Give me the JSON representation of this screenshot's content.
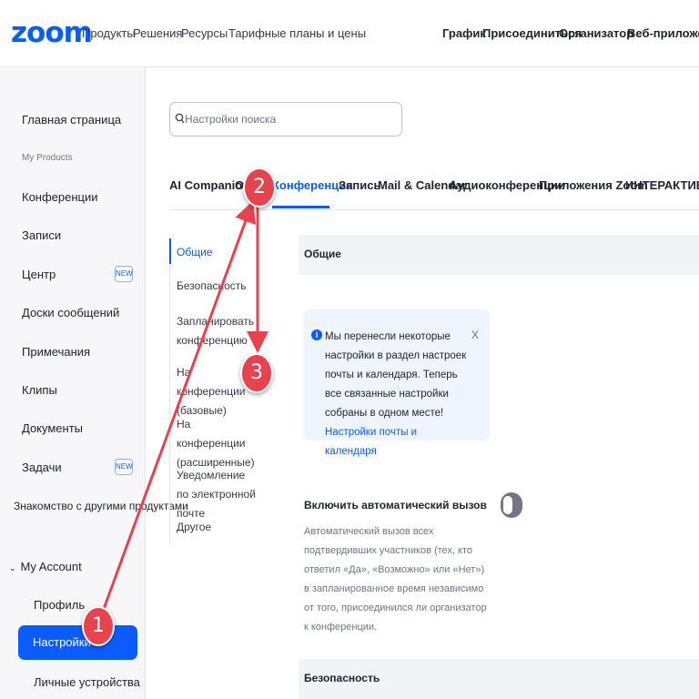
{
  "brand": {
    "logo_text": "zoom",
    "accent_color": "#0b5cff"
  },
  "topnav": {
    "left_links": [
      "Продукты",
      "Решения",
      "Ресурсы",
      "Тарифные планы и цены"
    ],
    "right_links": [
      "График",
      "Присоединиться",
      "Организатор",
      "Веб-приложение"
    ]
  },
  "sidebar": {
    "items": [
      {
        "label": "Главная страница"
      },
      {
        "label": "My Products"
      },
      {
        "label": "Конференции"
      },
      {
        "label": "Записи"
      },
      {
        "label": "Центр",
        "badge": "NEW"
      },
      {
        "label": "Доски сообщений"
      },
      {
        "label": "Примечания"
      },
      {
        "label": "Клипы"
      },
      {
        "label": "Документы"
      },
      {
        "label": "Задачи",
        "badge": "NEW"
      },
      {
        "label": "Знакомство с другими продуктами"
      },
      {
        "label": "My Account"
      },
      {
        "label": "Профиль"
      },
      {
        "label": "Настройки",
        "active": true
      },
      {
        "label": "Личные устройства"
      }
    ]
  },
  "search": {
    "placeholder": "Настройки поиска",
    "value": ""
  },
  "tabs": [
    {
      "label": "AI Companion"
    },
    {
      "label": "Общие"
    },
    {
      "label": "Конференция",
      "active": true
    },
    {
      "label": "Запись"
    },
    {
      "label": "Mail & Calendar"
    },
    {
      "label": "Аудиоконференции"
    },
    {
      "label": "Приложения Zoom"
    },
    {
      "label": "ИНТЕРАКТИВНАЯ"
    }
  ],
  "subnav": [
    {
      "label": "Общие",
      "active": true
    },
    {
      "label": "Безопасность"
    },
    {
      "label": "Запланировать конференцию"
    },
    {
      "label": "На конференции (базовые)"
    },
    {
      "label": "На конференции (расширенные)"
    },
    {
      "label": "Уведомление по электронной почте"
    },
    {
      "label": "Другое"
    }
  ],
  "sections": {
    "general_title": "Общие",
    "security_title": "Безопасность"
  },
  "info_banner": {
    "text": "Мы перенесли некоторые настройки в раздел настроек почты и календаря. Теперь все связанные настройки собраны в одном месте!",
    "link_text": "Настройки почты и календаря",
    "close_label": "X"
  },
  "auto_call_setting": {
    "title": "Включить автоматический вызов",
    "description": "Автоматический вызов всех подтвердивших участников (тех, кто ответил «Да», «Возможно» или «Нет») в запланированное время независимо от того, присоединился ли организатор к конференции.",
    "enabled": false
  },
  "annotations": {
    "marker_1": "1",
    "marker_2": "2",
    "marker_3": "3",
    "color": "#e8424f"
  }
}
